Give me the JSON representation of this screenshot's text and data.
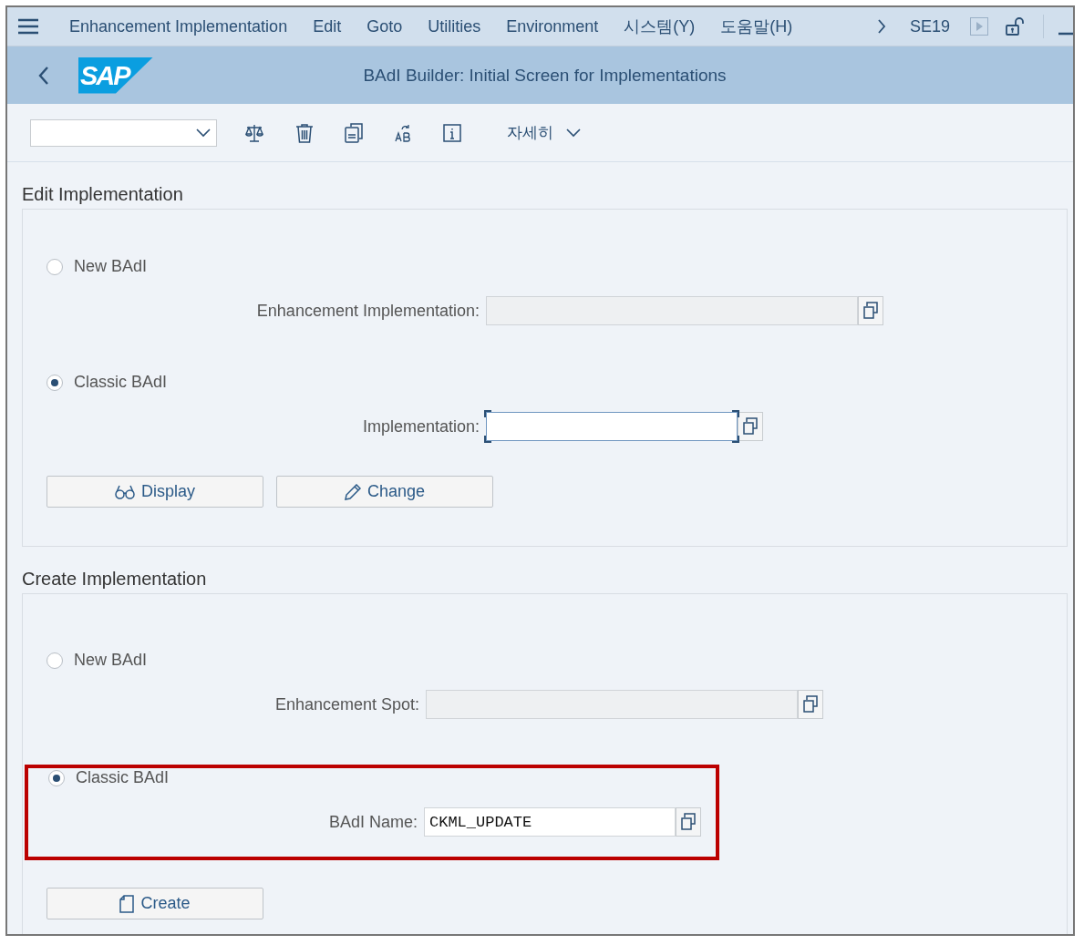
{
  "menu_bar": {
    "items": [
      "Enhancement Implementation",
      "Edit",
      "Goto",
      "Utilities",
      "Environment",
      "시스템(Y)",
      "도움말(H)"
    ],
    "transaction": "SE19"
  },
  "title_bar": {
    "logo": "SAP",
    "title": "BAdI Builder: Initial Screen for Implementations"
  },
  "toolbar": {
    "more_label": "자세히"
  },
  "sections": [
    {
      "title": "Edit Implementation",
      "options": [
        {
          "label": "New BAdI",
          "selected": false,
          "highlighted": false,
          "field": {
            "label": "Enhancement Implementation:",
            "disabled": true,
            "focused": false
          }
        },
        {
          "label": "Classic BAdI",
          "selected": true,
          "highlighted": false,
          "field": {
            "label": "Implementation:",
            "disabled": false,
            "focused": true
          }
        }
      ],
      "buttons": [
        {
          "label": "Display",
          "kind": "display"
        },
        {
          "label": "Change",
          "kind": "change"
        }
      ]
    },
    {
      "title": "Create Implementation",
      "options": [
        {
          "label": "New BAdI",
          "selected": false,
          "highlighted": false,
          "field": {
            "label": "Enhancement Spot:",
            "disabled": true,
            "focused": false
          }
        },
        {
          "label": "Classic BAdI",
          "selected": true,
          "highlighted": true,
          "field": {
            "label": "BAdI Name:",
            "value": "CKML_UPDATE",
            "disabled": false,
            "focused": false
          }
        }
      ],
      "buttons": [
        {
          "label": "Create",
          "kind": "create"
        }
      ]
    }
  ]
}
